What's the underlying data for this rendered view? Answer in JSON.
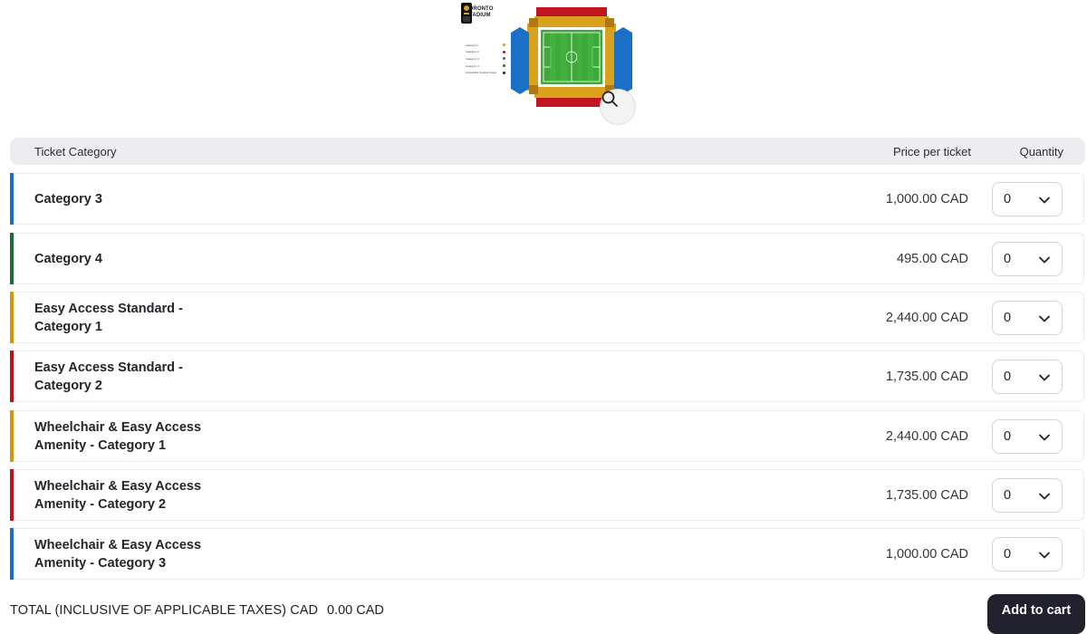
{
  "map": {
    "title_line1": "TORONTO",
    "title_line2": "STADIUM",
    "legend": [
      {
        "label": "Category 1",
        "color": "#d4960f"
      },
      {
        "label": "Category 2",
        "color": "#b8141c"
      },
      {
        "label": "Category 3",
        "color": "#1b6fc4"
      },
      {
        "label": "Category 4",
        "color": "#1f6b3a"
      },
      {
        "label": "Accessible Seating Areas",
        "color": "#222222"
      }
    ],
    "zoom_icon": "search-icon"
  },
  "table": {
    "col_category": "Ticket Category",
    "col_price": "Price per ticket",
    "col_quantity": "Quantity"
  },
  "rows": [
    {
      "name": "Category 3",
      "price": "1,000.00 CAD",
      "qty": "0",
      "color": "#1b6fc4"
    },
    {
      "name": "Category 4",
      "price": "495.00 CAD",
      "qty": "0",
      "color": "#1f6b3a"
    },
    {
      "name": "Easy Access Standard - Category 1",
      "price": "2,440.00 CAD",
      "qty": "0",
      "color": "#d4960f"
    },
    {
      "name": "Easy Access Standard - Category 2",
      "price": "1,735.00 CAD",
      "qty": "0",
      "color": "#b8141c"
    },
    {
      "name": "Wheelchair & Easy Access Amenity - Category 1",
      "price": "2,440.00 CAD",
      "qty": "0",
      "color": "#d4960f"
    },
    {
      "name": "Wheelchair & Easy Access Amenity - Category 2",
      "price": "1,735.00 CAD",
      "qty": "0",
      "color": "#b8141c"
    },
    {
      "name": "Wheelchair & Easy Access Amenity - Category 3",
      "price": "1,000.00 CAD",
      "qty": "0",
      "color": "#1b6fc4"
    }
  ],
  "footer": {
    "total_label": "TOTAL (INCLUSIVE OF APPLICABLE TAXES) CAD",
    "total_value": "0.00 CAD",
    "cart_label": "Add to cart"
  },
  "colors": {
    "cart_button": "#22212e",
    "header_bg": "#ececf1"
  }
}
